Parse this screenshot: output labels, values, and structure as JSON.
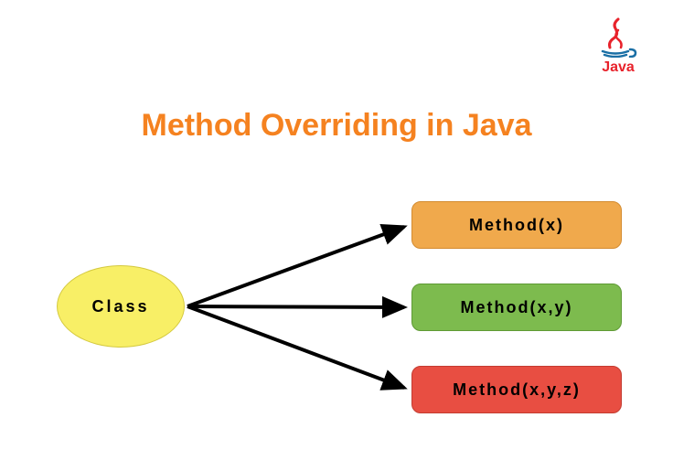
{
  "title": "Method Overriding in Java",
  "logo": {
    "label": "Java"
  },
  "class_node": {
    "label": "Class"
  },
  "methods": [
    {
      "label": "Method(x)"
    },
    {
      "label": "Method(x,y)"
    },
    {
      "label": "Method(x,y,z)"
    }
  ]
}
